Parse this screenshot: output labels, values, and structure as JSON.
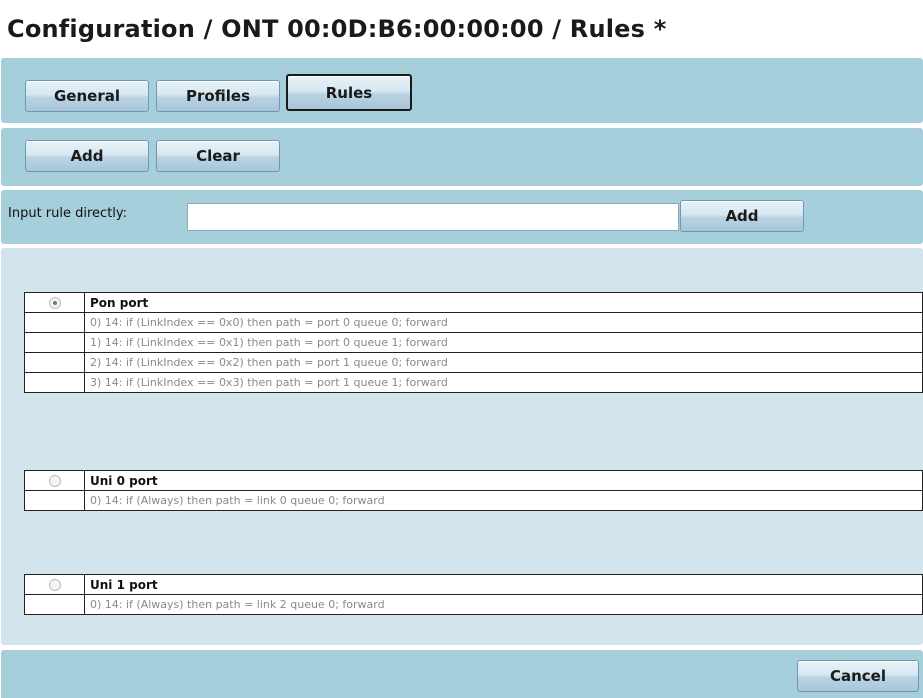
{
  "title": "Configuration / ONT 00:0D:B6:00:00:00 / Rules *",
  "tabs": [
    {
      "label": "General"
    },
    {
      "label": "Profiles"
    },
    {
      "label": "Rules"
    }
  ],
  "actions": {
    "add_label": "Add",
    "clear_label": "Clear"
  },
  "direct_input": {
    "label": "Input rule directly:",
    "value": "",
    "placeholder": "",
    "add_label": "Add"
  },
  "ports": [
    {
      "name": "Pon port",
      "selected": true,
      "rules": [
        "0) 14: if (LinkIndex == 0x0) then path = port 0 queue 0; forward",
        "1) 14: if (LinkIndex == 0x1) then path = port 0 queue 1; forward",
        "2) 14: if (LinkIndex == 0x2) then path = port 1 queue 0; forward",
        "3) 14: if (LinkIndex == 0x3) then path = port 1 queue 1; forward"
      ]
    },
    {
      "name": "Uni 0 port",
      "selected": false,
      "rules": [
        "0) 14: if (Always) then path = link 0 queue 0; forward"
      ]
    },
    {
      "name": "Uni 1 port",
      "selected": false,
      "rules": [
        "0) 14: if (Always) then path = link 2 queue 0; forward"
      ]
    }
  ],
  "footer": {
    "cancel_label": "Cancel"
  },
  "colors": {
    "panel": "#a6cfdc",
    "rules_panel": "#d3e4ed",
    "button_border": "#6f97b2"
  }
}
